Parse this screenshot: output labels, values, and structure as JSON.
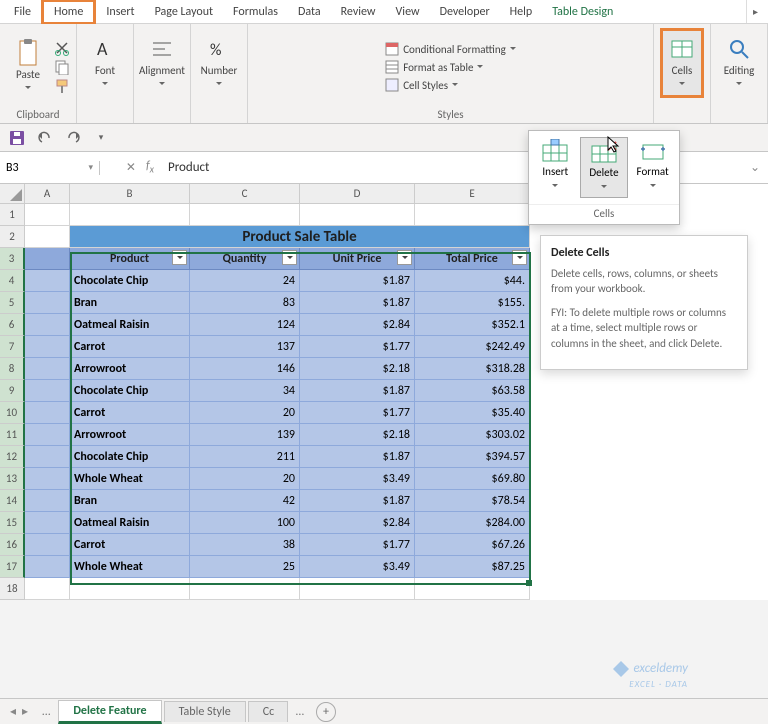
{
  "ribbon": {
    "tabs": [
      "File",
      "Home",
      "Insert",
      "Page Layout",
      "Formulas",
      "Data",
      "Review",
      "View",
      "Developer",
      "Help",
      "Table Design"
    ],
    "active_tab": "Home",
    "groups": {
      "clipboard": {
        "label": "Clipboard",
        "paste": "Paste"
      },
      "font": {
        "label": "Font"
      },
      "alignment": {
        "label": "Alignment"
      },
      "number": {
        "label": "Number"
      },
      "styles": {
        "label": "Styles",
        "items": [
          "Conditional Formatting",
          "Format as Table",
          "Cell Styles"
        ]
      },
      "cells": {
        "label": "Cells"
      },
      "editing": {
        "label": "Editing"
      }
    }
  },
  "cells_popup": {
    "insert": "Insert",
    "delete": "Delete",
    "format": "Format",
    "group_label": "Cells"
  },
  "tooltip": {
    "title": "Delete Cells",
    "body": "Delete cells, rows, columns, or sheets from your workbook.",
    "fyi": "FYI: To delete multiple rows or columns at a time, select multiple rows or columns in the sheet, and click Delete."
  },
  "name_box": "B3",
  "formula": "Product",
  "title": "Product Sale Table",
  "headers": {
    "product": "Product",
    "quantity": "Quantity",
    "unit_price": "Unit Price",
    "total_price": "Total Price"
  },
  "rows": [
    {
      "p": "Chocolate Chip",
      "q": "24",
      "u": "$1.87",
      "t": "$44."
    },
    {
      "p": "Bran",
      "q": "83",
      "u": "$1.87",
      "t": "$155."
    },
    {
      "p": "Oatmeal Raisin",
      "q": "124",
      "u": "$2.84",
      "t": "$352.1"
    },
    {
      "p": "Carrot",
      "q": "137",
      "u": "$1.77",
      "t": "$242.49"
    },
    {
      "p": "Arrowroot",
      "q": "146",
      "u": "$2.18",
      "t": "$318.28"
    },
    {
      "p": "Chocolate Chip",
      "q": "34",
      "u": "$1.87",
      "t": "$63.58"
    },
    {
      "p": "Carrot",
      "q": "20",
      "u": "$1.77",
      "t": "$35.40"
    },
    {
      "p": "Arrowroot",
      "q": "139",
      "u": "$2.18",
      "t": "$303.02"
    },
    {
      "p": "Chocolate Chip",
      "q": "211",
      "u": "$1.87",
      "t": "$394.57"
    },
    {
      "p": "Whole Wheat",
      "q": "20",
      "u": "$3.49",
      "t": "$69.80"
    },
    {
      "p": "Bran",
      "q": "42",
      "u": "$1.87",
      "t": "$78.54"
    },
    {
      "p": "Oatmeal Raisin",
      "q": "100",
      "u": "$2.84",
      "t": "$284.00"
    },
    {
      "p": "Carrot",
      "q": "38",
      "u": "$1.77",
      "t": "$67.26"
    },
    {
      "p": "Whole Wheat",
      "q": "25",
      "u": "$3.49",
      "t": "$87.25"
    }
  ],
  "sheets": {
    "active": "Delete Feature",
    "other": "Table Style",
    "hidden": "Cc"
  },
  "col_labels": [
    "A",
    "B",
    "C",
    "D",
    "E"
  ],
  "watermark": {
    "brand": "exceldemy",
    "tag": "EXCEL · DATA"
  }
}
